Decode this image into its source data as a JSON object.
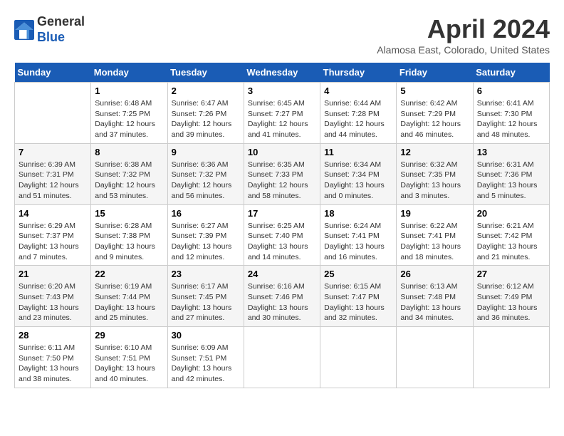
{
  "logo": {
    "general": "General",
    "blue": "Blue"
  },
  "header": {
    "month": "April 2024",
    "location": "Alamosa East, Colorado, United States"
  },
  "weekdays": [
    "Sunday",
    "Monday",
    "Tuesday",
    "Wednesday",
    "Thursday",
    "Friday",
    "Saturday"
  ],
  "weeks": [
    [
      {
        "day": "",
        "empty": true
      },
      {
        "day": "1",
        "sunrise": "6:48 AM",
        "sunset": "7:25 PM",
        "daylight": "12 hours and 37 minutes."
      },
      {
        "day": "2",
        "sunrise": "6:47 AM",
        "sunset": "7:26 PM",
        "daylight": "12 hours and 39 minutes."
      },
      {
        "day": "3",
        "sunrise": "6:45 AM",
        "sunset": "7:27 PM",
        "daylight": "12 hours and 41 minutes."
      },
      {
        "day": "4",
        "sunrise": "6:44 AM",
        "sunset": "7:28 PM",
        "daylight": "12 hours and 44 minutes."
      },
      {
        "day": "5",
        "sunrise": "6:42 AM",
        "sunset": "7:29 PM",
        "daylight": "12 hours and 46 minutes."
      },
      {
        "day": "6",
        "sunrise": "6:41 AM",
        "sunset": "7:30 PM",
        "daylight": "12 hours and 48 minutes."
      }
    ],
    [
      {
        "day": "7",
        "sunrise": "6:39 AM",
        "sunset": "7:31 PM",
        "daylight": "12 hours and 51 minutes."
      },
      {
        "day": "8",
        "sunrise": "6:38 AM",
        "sunset": "7:32 PM",
        "daylight": "12 hours and 53 minutes."
      },
      {
        "day": "9",
        "sunrise": "6:36 AM",
        "sunset": "7:32 PM",
        "daylight": "12 hours and 56 minutes."
      },
      {
        "day": "10",
        "sunrise": "6:35 AM",
        "sunset": "7:33 PM",
        "daylight": "12 hours and 58 minutes."
      },
      {
        "day": "11",
        "sunrise": "6:34 AM",
        "sunset": "7:34 PM",
        "daylight": "13 hours and 0 minutes."
      },
      {
        "day": "12",
        "sunrise": "6:32 AM",
        "sunset": "7:35 PM",
        "daylight": "13 hours and 3 minutes."
      },
      {
        "day": "13",
        "sunrise": "6:31 AM",
        "sunset": "7:36 PM",
        "daylight": "13 hours and 5 minutes."
      }
    ],
    [
      {
        "day": "14",
        "sunrise": "6:29 AM",
        "sunset": "7:37 PM",
        "daylight": "13 hours and 7 minutes."
      },
      {
        "day": "15",
        "sunrise": "6:28 AM",
        "sunset": "7:38 PM",
        "daylight": "13 hours and 9 minutes."
      },
      {
        "day": "16",
        "sunrise": "6:27 AM",
        "sunset": "7:39 PM",
        "daylight": "13 hours and 12 minutes."
      },
      {
        "day": "17",
        "sunrise": "6:25 AM",
        "sunset": "7:40 PM",
        "daylight": "13 hours and 14 minutes."
      },
      {
        "day": "18",
        "sunrise": "6:24 AM",
        "sunset": "7:41 PM",
        "daylight": "13 hours and 16 minutes."
      },
      {
        "day": "19",
        "sunrise": "6:22 AM",
        "sunset": "7:41 PM",
        "daylight": "13 hours and 18 minutes."
      },
      {
        "day": "20",
        "sunrise": "6:21 AM",
        "sunset": "7:42 PM",
        "daylight": "13 hours and 21 minutes."
      }
    ],
    [
      {
        "day": "21",
        "sunrise": "6:20 AM",
        "sunset": "7:43 PM",
        "daylight": "13 hours and 23 minutes."
      },
      {
        "day": "22",
        "sunrise": "6:19 AM",
        "sunset": "7:44 PM",
        "daylight": "13 hours and 25 minutes."
      },
      {
        "day": "23",
        "sunrise": "6:17 AM",
        "sunset": "7:45 PM",
        "daylight": "13 hours and 27 minutes."
      },
      {
        "day": "24",
        "sunrise": "6:16 AM",
        "sunset": "7:46 PM",
        "daylight": "13 hours and 30 minutes."
      },
      {
        "day": "25",
        "sunrise": "6:15 AM",
        "sunset": "7:47 PM",
        "daylight": "13 hours and 32 minutes."
      },
      {
        "day": "26",
        "sunrise": "6:13 AM",
        "sunset": "7:48 PM",
        "daylight": "13 hours and 34 minutes."
      },
      {
        "day": "27",
        "sunrise": "6:12 AM",
        "sunset": "7:49 PM",
        "daylight": "13 hours and 36 minutes."
      }
    ],
    [
      {
        "day": "28",
        "sunrise": "6:11 AM",
        "sunset": "7:50 PM",
        "daylight": "13 hours and 38 minutes."
      },
      {
        "day": "29",
        "sunrise": "6:10 AM",
        "sunset": "7:51 PM",
        "daylight": "13 hours and 40 minutes."
      },
      {
        "day": "30",
        "sunrise": "6:09 AM",
        "sunset": "7:51 PM",
        "daylight": "13 hours and 42 minutes."
      },
      {
        "day": "",
        "empty": true
      },
      {
        "day": "",
        "empty": true
      },
      {
        "day": "",
        "empty": true
      },
      {
        "day": "",
        "empty": true
      }
    ]
  ],
  "labels": {
    "sunrise": "Sunrise:",
    "sunset": "Sunset:",
    "daylight": "Daylight:"
  }
}
